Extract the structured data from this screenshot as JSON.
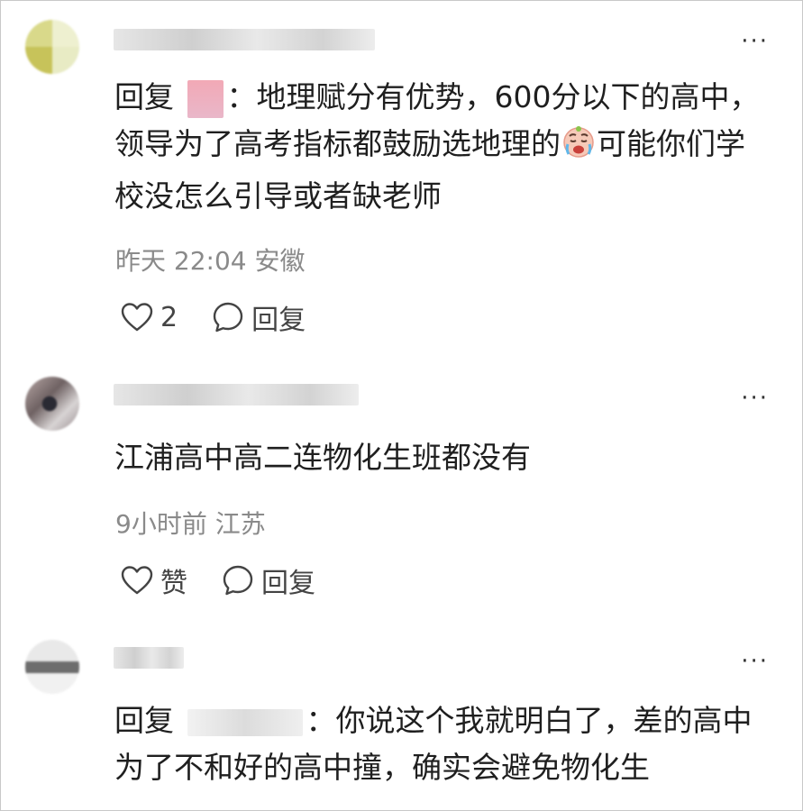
{
  "comments": [
    {
      "reply_prefix": "回复",
      "text_before_emoji": "：地理赋分有优势，600分以下的高中，领导为了高考指标都鼓励选地理的",
      "text_after_emoji": "可能你们学校没怎么引导或者缺老师",
      "emoji_name": "crying-face",
      "time": "昨天 22:04",
      "location": "安徽",
      "like_count": "2",
      "reply_label": "回复",
      "more": "···"
    },
    {
      "text": "江浦高中高二连物化生班都没有",
      "time": "9小时前",
      "location": "江苏",
      "like_label": "赞",
      "reply_label": "回复",
      "more": "···"
    },
    {
      "reply_prefix": "回复",
      "text": "：你说这个我就明白了，差的高中为了不和好的高中撞，确实会避免物化生",
      "more": "···"
    }
  ],
  "colors": {
    "text": "#1f1f1f",
    "meta": "#8a8a8a",
    "icon": "#444444"
  }
}
